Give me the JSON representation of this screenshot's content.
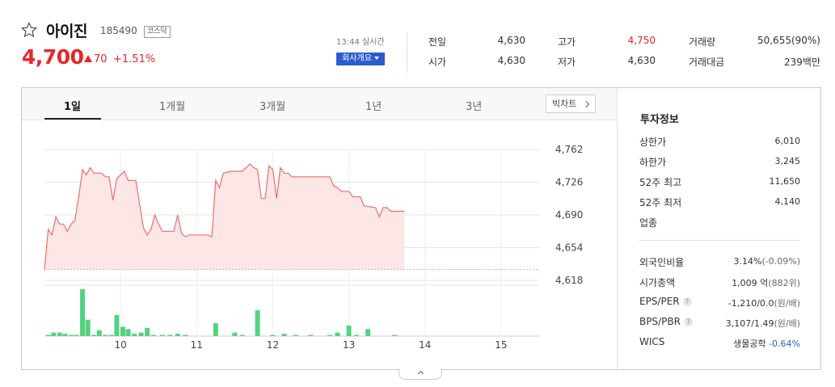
{
  "stock": {
    "name": "아이진",
    "code": "185490",
    "market": "코스닥",
    "price": "4,700",
    "change": "70",
    "change_rate": "+1.51%",
    "time": "13:44 실시간",
    "corp_button": "회사개요"
  },
  "quote": {
    "prev_close_label": "전일",
    "prev_close": "4,630",
    "open_label": "시가",
    "open": "4,630",
    "high_label": "고가",
    "high": "4,750",
    "low_label": "저가",
    "low": "4,630",
    "volume_label": "거래량",
    "volume": "50,655(90%)",
    "amount_label": "거래대금",
    "amount": "239백만"
  },
  "tabs": [
    "1일",
    "1개월",
    "3개월",
    "1년",
    "3년"
  ],
  "active_tab": "1일",
  "big_chart_button": "빅차트",
  "colors": {
    "up": "#e8262b",
    "down": "#2b5ccf",
    "volume": "#52d37f"
  },
  "chart_data": {
    "type": "line",
    "y_ticks": [
      "4,762",
      "4,726",
      "4,690",
      "4,654",
      "4,618"
    ],
    "ylim": [
      4618,
      4762
    ],
    "x_ticks": [
      "10",
      "11",
      "12",
      "13",
      "14",
      "15"
    ],
    "xlim": [
      9.0,
      15.5
    ],
    "baseline": 4630,
    "series": [
      {
        "values": [
          [
            9.0,
            4630
          ],
          [
            9.05,
            4674
          ],
          [
            9.1,
            4668
          ],
          [
            9.15,
            4688
          ],
          [
            9.2,
            4680
          ],
          [
            9.25,
            4680
          ],
          [
            9.3,
            4672
          ],
          [
            9.35,
            4680
          ],
          [
            9.4,
            4684
          ],
          [
            9.45,
            4710
          ],
          [
            9.5,
            4740
          ],
          [
            9.55,
            4734
          ],
          [
            9.6,
            4742
          ],
          [
            9.65,
            4736
          ],
          [
            9.75,
            4736
          ],
          [
            9.8,
            4732
          ],
          [
            9.85,
            4732
          ],
          [
            9.9,
            4706
          ],
          [
            9.95,
            4730
          ],
          [
            10.0,
            4734
          ],
          [
            10.05,
            4738
          ],
          [
            10.1,
            4728
          ],
          [
            10.2,
            4728
          ],
          [
            10.25,
            4702
          ],
          [
            10.3,
            4676
          ],
          [
            10.35,
            4668
          ],
          [
            10.4,
            4674
          ],
          [
            10.45,
            4690
          ],
          [
            10.5,
            4680
          ],
          [
            10.55,
            4672
          ],
          [
            10.7,
            4672
          ],
          [
            10.75,
            4690
          ],
          [
            10.8,
            4670
          ],
          [
            10.85,
            4666
          ],
          [
            10.9,
            4668
          ],
          [
            11.15,
            4668
          ],
          [
            11.2,
            4666
          ],
          [
            11.25,
            4728
          ],
          [
            11.3,
            4720
          ],
          [
            11.35,
            4736
          ],
          [
            11.45,
            4738
          ],
          [
            11.6,
            4738
          ],
          [
            11.65,
            4742
          ],
          [
            11.7,
            4746
          ],
          [
            11.75,
            4742
          ],
          [
            11.8,
            4740
          ],
          [
            11.85,
            4708
          ],
          [
            11.9,
            4708
          ],
          [
            11.95,
            4744
          ],
          [
            12.0,
            4740
          ],
          [
            12.05,
            4708
          ],
          [
            12.1,
            4742
          ],
          [
            12.15,
            4736
          ],
          [
            12.2,
            4736
          ],
          [
            12.25,
            4732
          ],
          [
            12.3,
            4732
          ],
          [
            12.75,
            4732
          ],
          [
            12.8,
            4722
          ],
          [
            12.85,
            4720
          ],
          [
            12.9,
            4716
          ],
          [
            13.0,
            4716
          ],
          [
            13.05,
            4710
          ],
          [
            13.15,
            4710
          ],
          [
            13.2,
            4700
          ],
          [
            13.35,
            4698
          ],
          [
            13.4,
            4688
          ],
          [
            13.45,
            4698
          ],
          [
            13.5,
            4698
          ],
          [
            13.55,
            4694
          ],
          [
            13.65,
            4694
          ],
          [
            13.73,
            4694
          ]
        ]
      },
      {
        "name": "volume",
        "values": [
          [
            9.05,
            1
          ],
          [
            9.12,
            3
          ],
          [
            9.2,
            3
          ],
          [
            9.27,
            2
          ],
          [
            9.35,
            1
          ],
          [
            9.42,
            1
          ],
          [
            9.5,
            40
          ],
          [
            9.57,
            14
          ],
          [
            9.65,
            1
          ],
          [
            9.72,
            5
          ],
          [
            9.8,
            1
          ],
          [
            9.88,
            1
          ],
          [
            9.95,
            18
          ],
          [
            10.03,
            8
          ],
          [
            10.1,
            6
          ],
          [
            10.18,
            2
          ],
          [
            10.27,
            3
          ],
          [
            10.35,
            7
          ],
          [
            10.43,
            1
          ],
          [
            10.55,
            1
          ],
          [
            10.65,
            1
          ],
          [
            10.75,
            2
          ],
          [
            10.85,
            1
          ],
          [
            11.25,
            11
          ],
          [
            11.5,
            3
          ],
          [
            11.6,
            1
          ],
          [
            11.8,
            22
          ],
          [
            12.0,
            1
          ],
          [
            12.15,
            2
          ],
          [
            12.3,
            1
          ],
          [
            12.5,
            1
          ],
          [
            12.75,
            1
          ],
          [
            12.85,
            3
          ],
          [
            13.0,
            9
          ],
          [
            13.1,
            1
          ],
          [
            13.25,
            6
          ],
          [
            13.6,
            1
          ]
        ]
      }
    ]
  },
  "invest": {
    "title": "투자정보",
    "upper_limit_label": "상한가",
    "upper_limit": "6,010",
    "lower_limit_label": "하한가",
    "lower_limit": "3,245",
    "w52_high_label": "52주 최고",
    "w52_high": "11,650",
    "w52_low_label": "52주 최저",
    "w52_low": "4,140",
    "sector_label": "업종",
    "foreign_label": "외국인비율",
    "foreign": "3.14%",
    "foreign_chg": "(-0.09%)",
    "mcap_label": "시가총액",
    "mcap": "1,009 억",
    "mcap_sub": "(882위)",
    "eps_label": "EPS/PER",
    "eps": "-1,210/0.0",
    "eps_unit": "(원/배)",
    "bps_label": "BPS/PBR",
    "bps": "3,107/1.49",
    "bps_unit": "(원/배)",
    "wics_label": "WICS",
    "wics": "생물공학",
    "wics_chg": "-0.64%"
  },
  "help_mark": "?"
}
